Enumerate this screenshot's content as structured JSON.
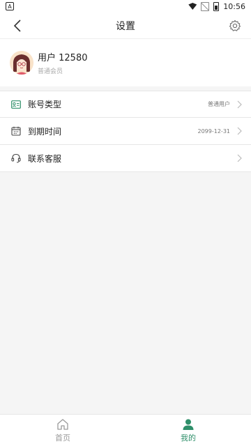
{
  "status_bar": {
    "time": "10:56",
    "app_badge": "A"
  },
  "header": {
    "title": "设置"
  },
  "profile": {
    "name": "用户 12580",
    "level": "普通会员"
  },
  "settings": {
    "items": [
      {
        "label": "账号类型",
        "value": "普通用户",
        "icon": "id-card-icon"
      },
      {
        "label": "到期时间",
        "value": "2099-12-31",
        "icon": "calendar-icon"
      },
      {
        "label": "联系客服",
        "value": "",
        "icon": "headset-icon"
      }
    ]
  },
  "tabs": [
    {
      "label": "首页",
      "icon": "home-icon",
      "active": false
    },
    {
      "label": "我的",
      "icon": "user-icon",
      "active": true
    }
  ],
  "colors": {
    "accent": "#2f8f6a",
    "background": "#f5f5f5"
  }
}
